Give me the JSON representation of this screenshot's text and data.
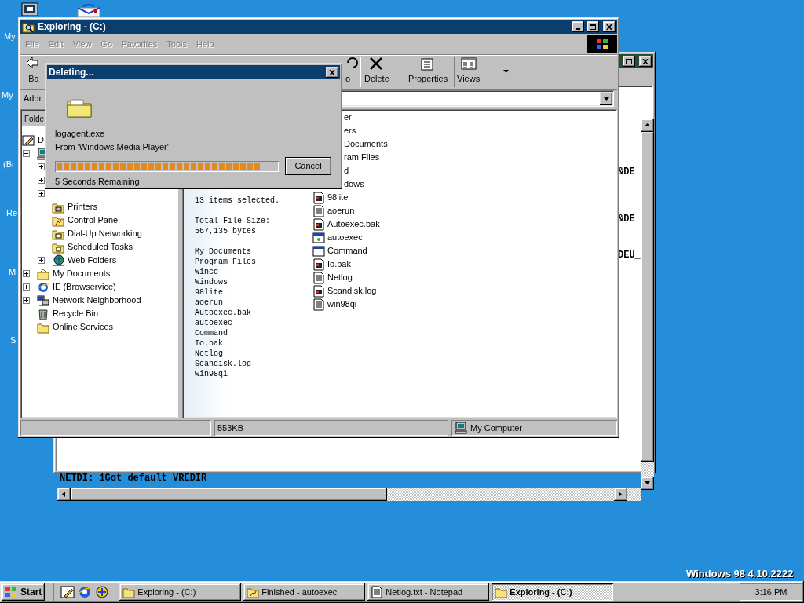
{
  "desktop": {
    "icon_labels": [
      "My",
      "My",
      "(Br",
      "Re",
      "M",
      "S"
    ],
    "version_text": "Windows 98 4.10.2222"
  },
  "notepad_window": {
    "text_fragments": [
      "&DE",
      "&DE",
      "DEU_"
    ],
    "last_line": "NETDI: 1Got default VREDIR"
  },
  "explorer": {
    "title": "Exploring -  (C:)",
    "menu": [
      {
        "label": "File",
        "disabled": true
      },
      {
        "label": "Edit",
        "disabled": true
      },
      {
        "label": "View",
        "disabled": true
      },
      {
        "label": "Go",
        "disabled": true
      },
      {
        "label": "Favorites",
        "disabled": true
      },
      {
        "label": "Tools",
        "disabled": true
      },
      {
        "label": "Help",
        "disabled": true
      }
    ],
    "toolbar": [
      {
        "label": "Ba"
      },
      {
        "label": "o"
      },
      {
        "label": "Delete"
      },
      {
        "label": "Properties"
      },
      {
        "label": "Views"
      }
    ],
    "address_label": "Addr",
    "folders_label": "Folde",
    "tree": [
      {
        "label": "D",
        "children": [
          {
            "expanded": true,
            "children": [
              {
                "expanded": false
              },
              {
                "expanded": false
              },
              {
                "expanded": false
              },
              {
                "label": "Printers"
              },
              {
                "label": "Control Panel"
              },
              {
                "label": "Dial-Up Networking"
              },
              {
                "label": "Scheduled Tasks"
              },
              {
                "label": "Web Folders",
                "expanded": false
              }
            ]
          },
          {
            "label": "My Documents",
            "expanded": false
          },
          {
            "label": "IE (Browservice)",
            "expanded": false
          },
          {
            "label": "Network Neighborhood",
            "expanded": false
          },
          {
            "label": "Recycle Bin"
          },
          {
            "label": "Online Services"
          }
        ]
      }
    ],
    "web_view": {
      "summary": "13 items selected.",
      "size_label": "Total File Size:",
      "size_value": "567,135 bytes",
      "selected_names": [
        "My Documents",
        "Program Files",
        "Wincd",
        "Windows",
        "98lite",
        "aoerun",
        "Autoexec.bak",
        "autoexec",
        "Command",
        "Io.bak",
        "Netlog",
        "Scandisk.log",
        "win98qi"
      ]
    },
    "files": [
      {
        "name": "er",
        "kind": "covered"
      },
      {
        "name": "ers",
        "kind": "covered"
      },
      {
        "name": "Documents",
        "kind": "covered"
      },
      {
        "name": "ram Files",
        "kind": "covered"
      },
      {
        "name": "d",
        "kind": "covered"
      },
      {
        "name": "dows",
        "kind": "covered"
      },
      {
        "name": "98lite",
        "kind": "file"
      },
      {
        "name": "aoerun",
        "kind": "file"
      },
      {
        "name": "Autoexec.bak",
        "kind": "file"
      },
      {
        "name": "autoexec",
        "kind": "file"
      },
      {
        "name": "Command",
        "kind": "file"
      },
      {
        "name": "Io.bak",
        "kind": "file"
      },
      {
        "name": "Netlog",
        "kind": "file"
      },
      {
        "name": "Scandisk.log",
        "kind": "file"
      },
      {
        "name": "win98qi",
        "kind": "file"
      }
    ],
    "status_bar": {
      "size": "553KB",
      "zone": "My Computer"
    }
  },
  "dialog": {
    "title": "Deleting...",
    "file": "logagent.exe",
    "source": "From 'Windows Media Player'",
    "progress": {
      "level": 0.93
    },
    "remaining": "5 Seconds Remaining",
    "button": "Cancel"
  },
  "taskbar": {
    "start": "Start",
    "tasks": [
      {
        "label": "Exploring - (C:)",
        "selected": false
      },
      {
        "label": "Finished - autoexec",
        "selected": false
      },
      {
        "label": "Netlog.txt - Notepad",
        "selected": false
      },
      {
        "label": "Exploring -  (C:)",
        "selected": true
      }
    ],
    "clock": "3:16 PM"
  }
}
